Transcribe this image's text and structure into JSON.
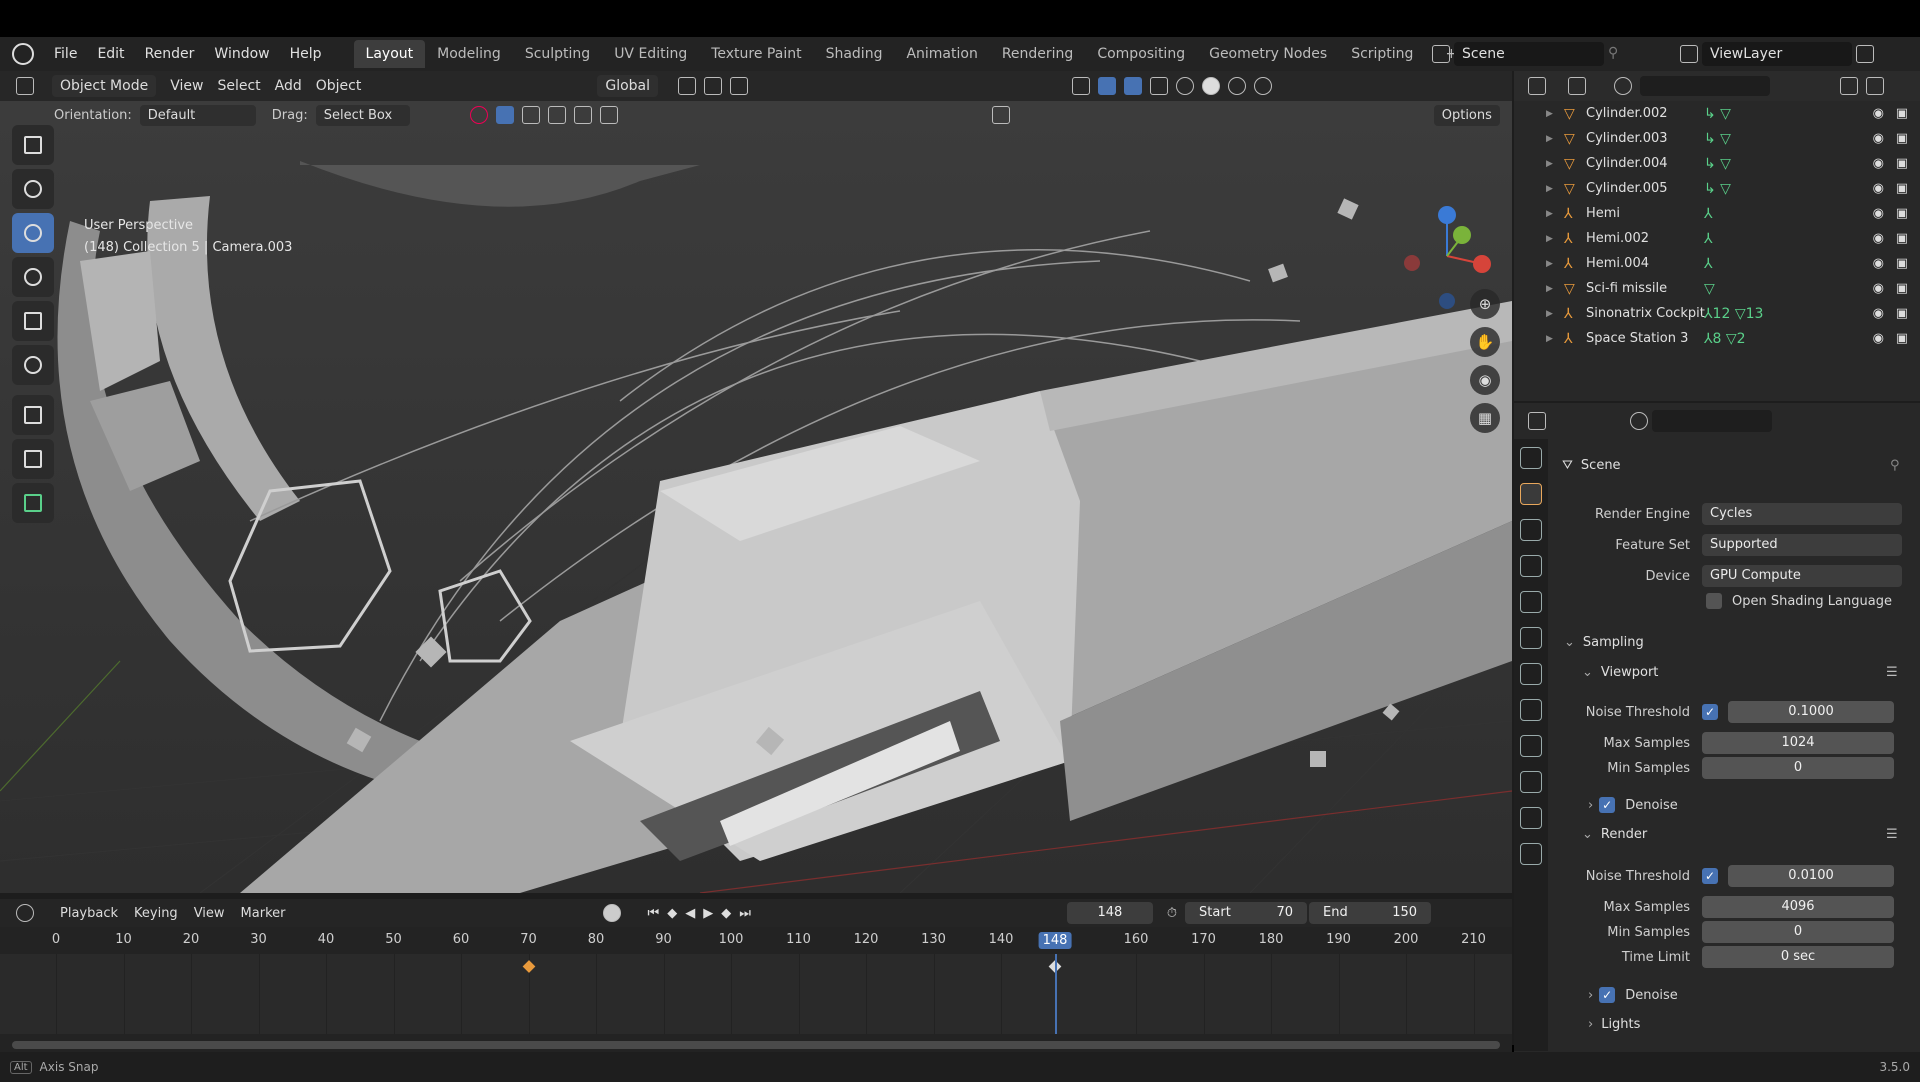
{
  "app": {
    "menu": [
      "File",
      "Edit",
      "Render",
      "Window",
      "Help"
    ]
  },
  "workspaces": [
    {
      "label": "Layout",
      "active": true
    },
    {
      "label": "Modeling"
    },
    {
      "label": "Sculpting"
    },
    {
      "label": "UV Editing"
    },
    {
      "label": "Texture Paint"
    },
    {
      "label": "Shading"
    },
    {
      "label": "Animation"
    },
    {
      "label": "Rendering"
    },
    {
      "label": "Compositing"
    },
    {
      "label": "Geometry Nodes"
    },
    {
      "label": "Scripting"
    }
  ],
  "scene": {
    "name": "Scene",
    "view_layer": "ViewLayer"
  },
  "viewport_header": {
    "mode": "Object Mode",
    "menus": [
      "View",
      "Select",
      "Add",
      "Object"
    ],
    "transform": "Global"
  },
  "tool_header": {
    "orientation_label": "Orientation:",
    "orientation": "Default",
    "drag_label": "Drag:",
    "drag": "Select Box",
    "options": "Options"
  },
  "viewport": {
    "perspective": "User Perspective",
    "info": "(148) Collection 5 | Camera.003"
  },
  "outliner": {
    "items": [
      {
        "name": "Cylinder.002",
        "type": "mesh",
        "modifiers": "↳ ▽"
      },
      {
        "name": "Cylinder.003",
        "type": "mesh",
        "modifiers": "↳ ▽"
      },
      {
        "name": "Cylinder.004",
        "type": "mesh",
        "modifiers": "↳ ▽"
      },
      {
        "name": "Cylinder.005",
        "type": "mesh",
        "modifiers": "↳ ▽"
      },
      {
        "name": "Hemi",
        "type": "empty",
        "modifiers": "⅄"
      },
      {
        "name": "Hemi.002",
        "type": "empty",
        "modifiers": "⅄"
      },
      {
        "name": "Hemi.004",
        "type": "empty",
        "modifiers": "⅄"
      },
      {
        "name": "Sci-fi missile",
        "type": "mesh",
        "modifiers": "▽"
      },
      {
        "name": "Sinonatrix Cockpit",
        "type": "empty",
        "modifiers": "⅄12 ▽13"
      },
      {
        "name": "Space Station 3",
        "type": "empty",
        "modifiers": "⅄8 ▽2"
      }
    ]
  },
  "properties": {
    "context": "Scene",
    "render_engine_label": "Render Engine",
    "render_engine": "Cycles",
    "feature_set_label": "Feature Set",
    "feature_set": "Supported",
    "device_label": "Device",
    "device": "GPU Compute",
    "osl_label": "Open Shading Language",
    "sampling": "Sampling",
    "viewport_section": "Viewport",
    "vp_noise_label": "Noise Threshold",
    "vp_noise": "0.1000",
    "vp_max_label": "Max Samples",
    "vp_max": "1024",
    "vp_min_label": "Min Samples",
    "vp_min": "0",
    "vp_denoise": "Denoise",
    "render_section": "Render",
    "r_noise_label": "Noise Threshold",
    "r_noise": "0.0100",
    "r_max_label": "Max Samples",
    "r_max": "4096",
    "r_min_label": "Min Samples",
    "r_min": "0",
    "r_time_label": "Time Limit",
    "r_time": "0 sec",
    "r_denoise": "Denoise",
    "lights": "Lights"
  },
  "timeline": {
    "menus": [
      "Playback",
      "Keying",
      "View",
      "Marker"
    ],
    "current_frame": "148",
    "start_label": "Start",
    "start": "70",
    "end_label": "End",
    "end": "150",
    "ticks": [
      "0",
      "10",
      "20",
      "30",
      "40",
      "50",
      "60",
      "70",
      "80",
      "90",
      "100",
      "110",
      "120",
      "130",
      "140",
      "148",
      "160",
      "170",
      "180",
      "190",
      "200",
      "210"
    ],
    "playhead_label": "148",
    "keyframes": [
      70,
      148
    ]
  },
  "status": {
    "key": "Alt",
    "hint": "Axis Snap",
    "version": "3.5.0"
  },
  "colors": {
    "accent": "#4772b3",
    "orange": "#e89a3c",
    "green": "#5ad08a"
  }
}
